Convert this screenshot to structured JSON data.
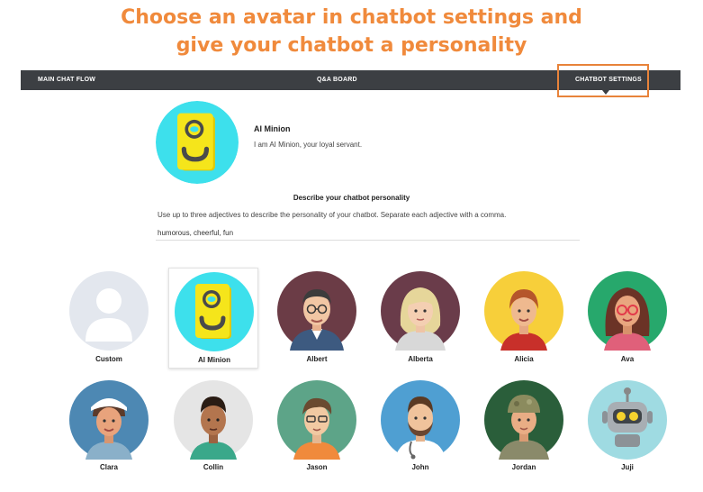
{
  "headline": {
    "line1": "Choose an avatar in chatbot settings and",
    "line2": "give your chatbot a personality"
  },
  "nav": {
    "main_chat_flow": "MAIN CHAT FLOW",
    "qa_board": "Q&A BOARD",
    "chatbot_settings": "CHATBOT SETTINGS",
    "active": "CHATBOT SETTINGS",
    "highlight_color": "#e8833a"
  },
  "bot": {
    "name": "AI Minion",
    "description": "I am AI Minion, your loyal servant."
  },
  "personality": {
    "title": "Describe your chatbot personality",
    "help": "Use up to three adjectives to describe the personality of your chatbot. Separate each adjective with a comma.",
    "value": "humorous, cheerful, fun"
  },
  "avatars": {
    "selected": "AI Minion",
    "row1": [
      "Custom",
      "AI Minion",
      "Albert",
      "Alberta",
      "Alicia",
      "Ava"
    ],
    "row2": [
      "Clara",
      "Collin",
      "Jason",
      "John",
      "Jordan",
      "Juji"
    ]
  },
  "colors": {
    "accent": "#f08a3c",
    "navbar": "#3c3f43",
    "minion_bg": "#3de0ec",
    "minion_body": "#f5e51b"
  }
}
